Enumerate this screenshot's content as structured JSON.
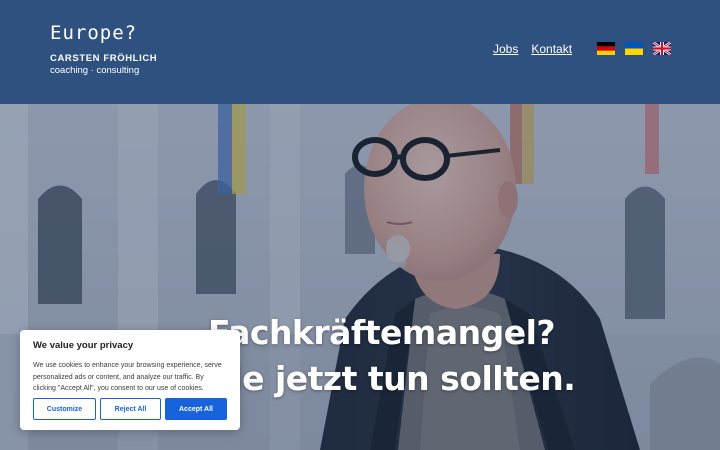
{
  "header": {
    "logo_mark": "Europe?",
    "logo_name": "CARSTEN FRÖHLICH",
    "logo_tagline": "coaching · consulting",
    "background": "#2f5180"
  },
  "nav": {
    "items": [
      {
        "label": "Jobs"
      },
      {
        "label": "Kontakt"
      }
    ]
  },
  "languages": [
    {
      "code": "de",
      "icon": "german-flag-icon"
    },
    {
      "code": "uk",
      "icon": "ukrainian-flag-icon"
    },
    {
      "code": "en",
      "icon": "uk-flag-icon"
    }
  ],
  "hero": {
    "heading_line1": "Fachkräftemangel?",
    "heading_line2": "Sie jetzt tun sollten."
  },
  "cookie_banner": {
    "title": "We value your privacy",
    "text": "We use cookies to enhance your browsing experience, serve personalized ads or content, and analyze our traffic. By clicking \"Accept All\", you consent to our use of cookies.",
    "customize_label": "Customize",
    "reject_label": "Reject All",
    "accept_label": "Accept All",
    "accent": "#1863dc"
  }
}
